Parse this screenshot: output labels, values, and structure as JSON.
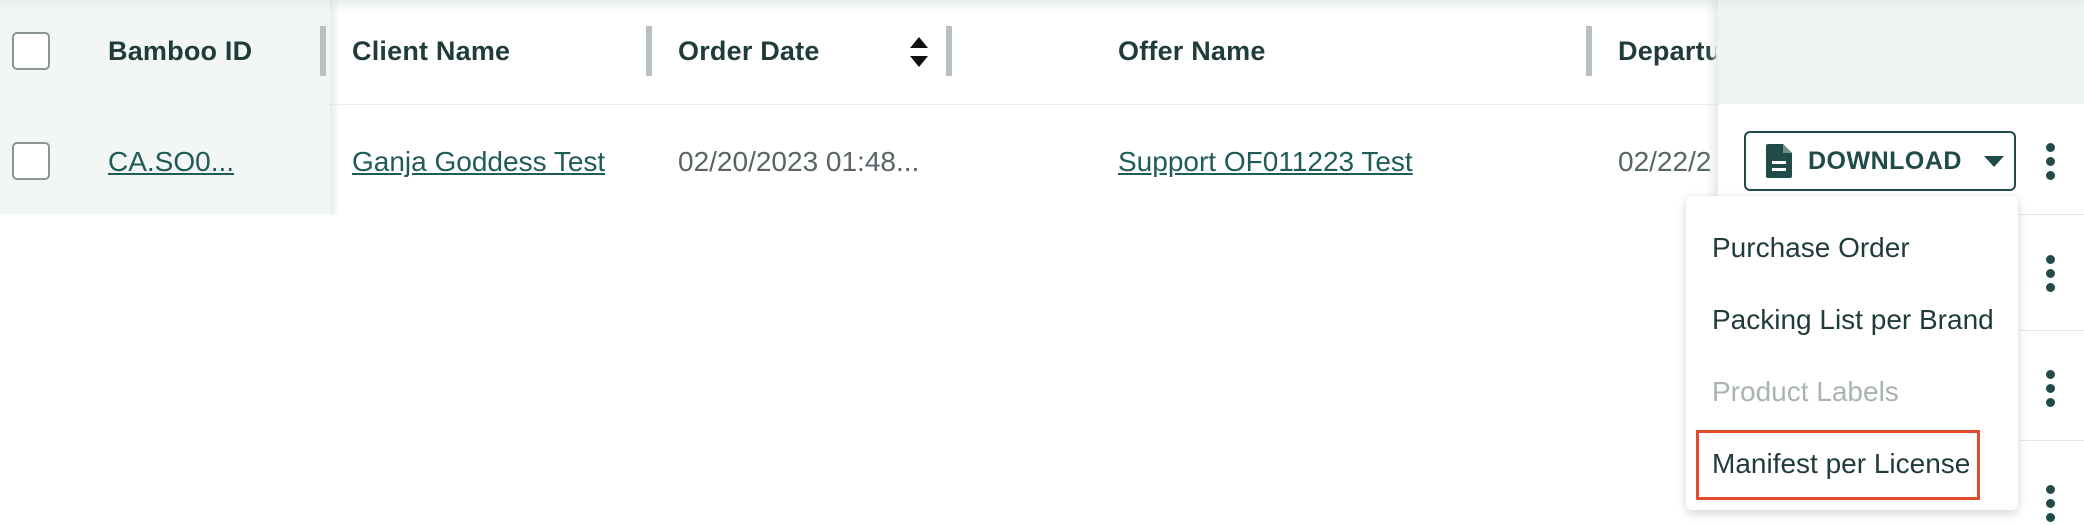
{
  "table": {
    "columns": {
      "bamboo_id": "Bamboo ID",
      "client_name": "Client Name",
      "order_date": "Order Date",
      "offer_name": "Offer Name",
      "departure": "Departu"
    },
    "row": {
      "bamboo_id": "CA.SO0...",
      "client_name": "Ganja Goddess Test",
      "order_date": "02/20/2023 01:48...",
      "offer_name": "Support OF011223 Test",
      "departure": "02/22/2"
    }
  },
  "actions": {
    "download_label": "DOWNLOAD",
    "download_icon": "document-icon",
    "kebab_icon": "more-vertical-icon"
  },
  "dropdown": {
    "items": [
      {
        "label": "Purchase Order",
        "disabled": false
      },
      {
        "label": "Packing List per Brand",
        "disabled": false
      },
      {
        "label": "Product Labels",
        "disabled": true
      },
      {
        "label": "Manifest per License",
        "disabled": false,
        "highlighted": true
      }
    ]
  },
  "colors": {
    "primary": "#1f4b48",
    "link": "#1f5b57",
    "highlight": "#e24b2e",
    "disabled": "#aab2b4"
  }
}
